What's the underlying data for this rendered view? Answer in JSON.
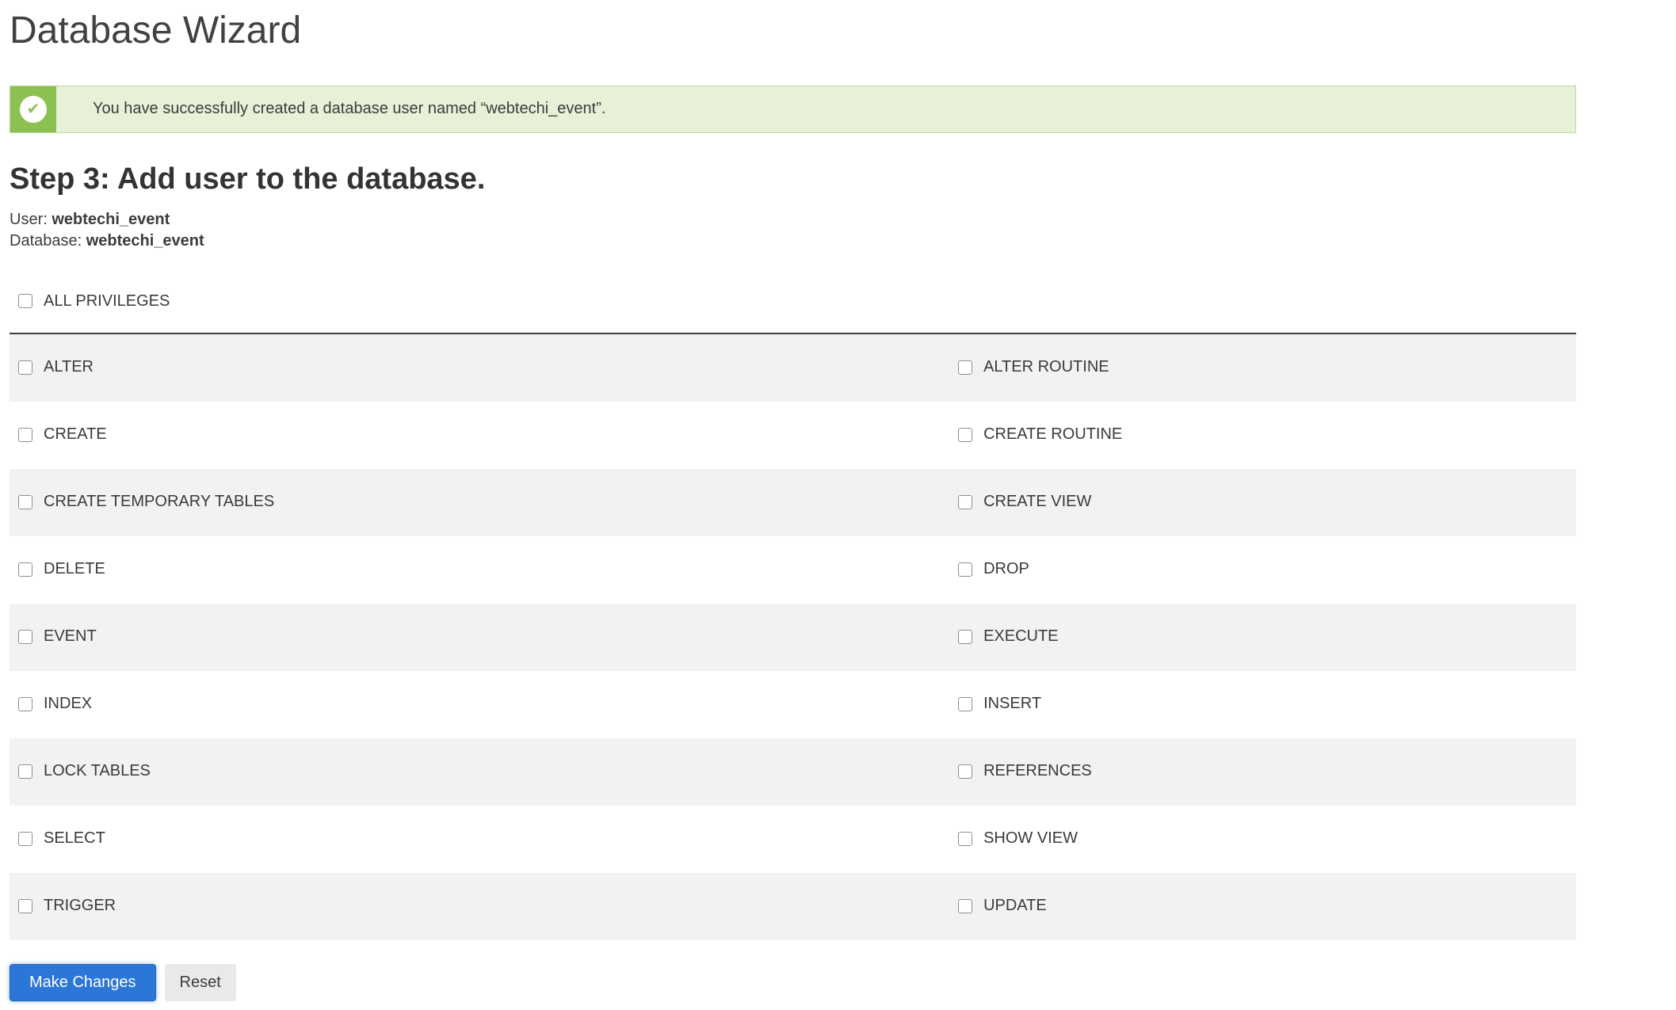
{
  "page": {
    "title": "Database Wizard"
  },
  "alert": {
    "type": "success",
    "icon_glyph": "✔",
    "message": "You have successfully created a database user named “webtechi_event”."
  },
  "step": {
    "heading": "Step 3: Add user to the database.",
    "user_label": "User:",
    "user_value": "webtechi_event",
    "database_label": "Database:",
    "database_value": "webtechi_event"
  },
  "privileges": {
    "all_label": "ALL PRIVILEGES",
    "rows": [
      {
        "left": "ALTER",
        "right": "ALTER ROUTINE"
      },
      {
        "left": "CREATE",
        "right": "CREATE ROUTINE"
      },
      {
        "left": "CREATE TEMPORARY TABLES",
        "right": "CREATE VIEW"
      },
      {
        "left": "DELETE",
        "right": "DROP"
      },
      {
        "left": "EVENT",
        "right": "EXECUTE"
      },
      {
        "left": "INDEX",
        "right": "INSERT"
      },
      {
        "left": "LOCK TABLES",
        "right": "REFERENCES"
      },
      {
        "left": "SELECT",
        "right": "SHOW VIEW"
      },
      {
        "left": "TRIGGER",
        "right": "UPDATE"
      }
    ]
  },
  "buttons": {
    "make_changes": "Make Changes",
    "reset": "Reset"
  },
  "colors": {
    "success_bg": "#e7f1d8",
    "success_border": "#bcd89a",
    "success_icon_bg": "#8cc152",
    "primary_button_bg": "#2b76d6",
    "row_alt_bg": "#f2f2f2",
    "table_top_border": "#3f3f3f"
  }
}
